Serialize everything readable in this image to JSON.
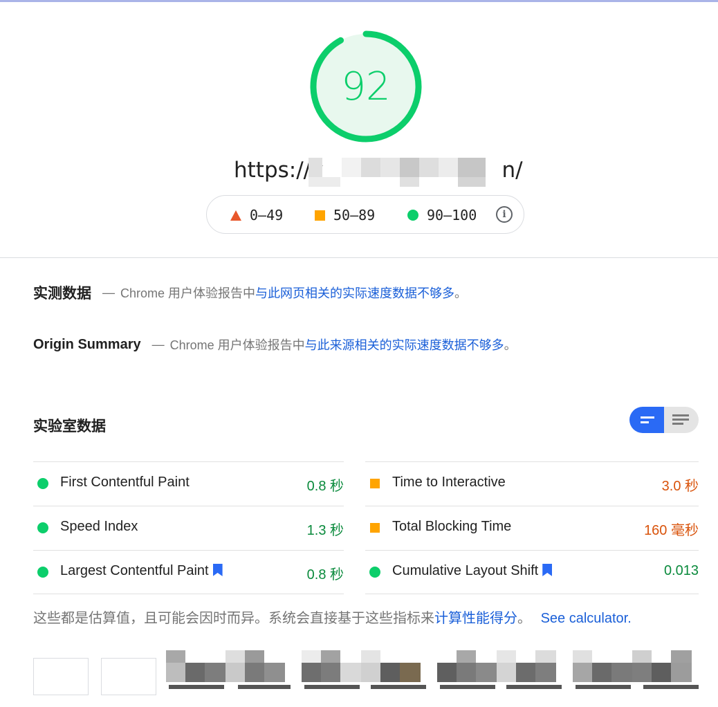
{
  "score": {
    "value": "92",
    "percent": 92,
    "color": "#0cce6b"
  },
  "url": {
    "prefix": "https://v",
    "suffix": "n/"
  },
  "legend": {
    "fail": "0–49",
    "average": "50–89",
    "pass": "90–100",
    "info": "i"
  },
  "field_data": {
    "title": "实测数据",
    "dash": "—",
    "prefix": "Chrome 用户体验报告中",
    "link": "与此网页相关的实际速度数据不够多",
    "suffix": "。"
  },
  "origin_summary": {
    "title": "Origin Summary",
    "dash": "—",
    "prefix": "Chrome 用户体验报告中",
    "link": "与此来源相关的实际速度数据不够多",
    "suffix": "。"
  },
  "lab_data": {
    "title": "实验室数据",
    "metrics_left": [
      {
        "name": "First Contentful Paint",
        "value": "0.8 秒",
        "status": "pass"
      },
      {
        "name": "Speed Index",
        "value": "1.3 秒",
        "status": "pass"
      },
      {
        "name": "Largest Contentful Paint",
        "value": "0.8 秒",
        "status": "pass"
      }
    ],
    "metrics_right": [
      {
        "name": "Time to Interactive",
        "value": "3.0 秒",
        "status": "average"
      },
      {
        "name": "Total Blocking Time",
        "value": "160 毫秒",
        "status": "average"
      },
      {
        "name": "Cumulative Layout Shift",
        "value": "0.013",
        "status": "pass"
      }
    ]
  },
  "footnote": {
    "text": "这些都是估算值，且可能会因时而异。系统会直接基于这些指标来",
    "link": "计算性能得分",
    "suffix": "。",
    "calc_link": "See calculator."
  },
  "colors": {
    "pass": "#0cce6b",
    "average": "#ffa400",
    "fail": "#e8572b",
    "link": "#1a5fd8",
    "toggle_active": "#2a6af5"
  }
}
